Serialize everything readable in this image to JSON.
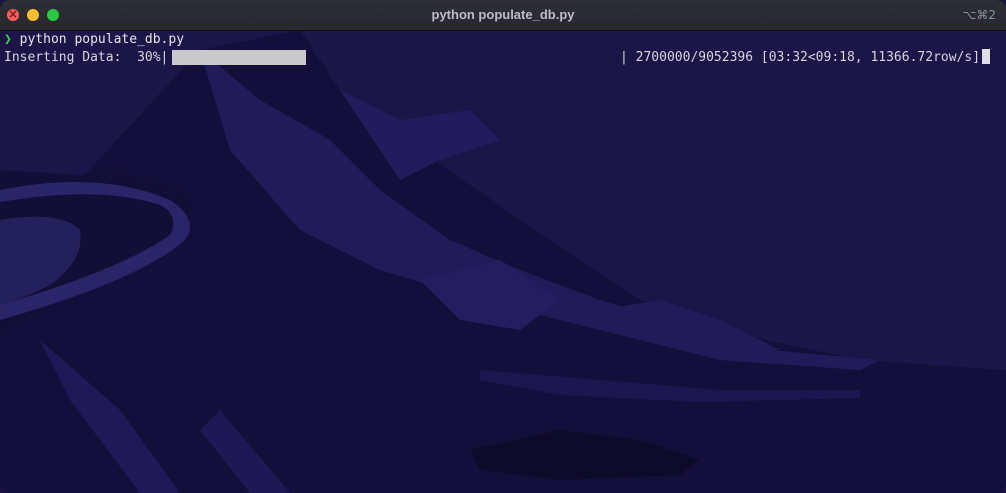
{
  "window": {
    "title": "python populate_db.py",
    "shortcut": "⌥⌘2"
  },
  "terminal": {
    "prompt_symbol": "❯",
    "command": "python populate_db.py",
    "progress": {
      "label": "Inserting Data:",
      "percent_text": "30%",
      "fraction": 0.3,
      "stats_text": "2700000/9052396 [03:32<09:18, 11366.72row/s]"
    }
  },
  "colors": {
    "background": "#1a1445",
    "prompt": "#39d353",
    "progress_fill": "#c9c9cd",
    "close": "#ff5f57",
    "minimize": "#febc2e",
    "maximize": "#28c840"
  },
  "icons": {
    "close": "close-icon",
    "minimize": "minimize-icon",
    "maximize": "maximize-icon"
  }
}
